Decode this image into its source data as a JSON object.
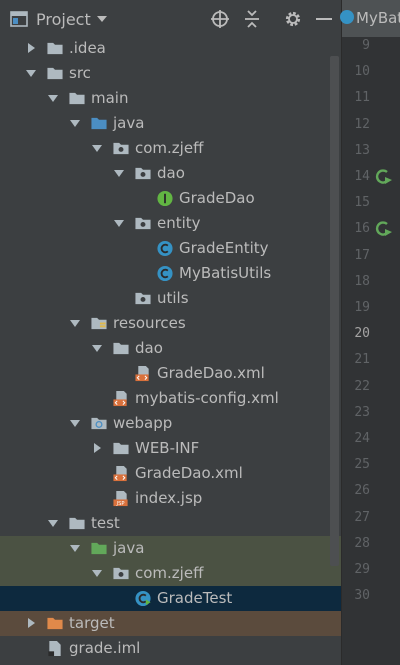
{
  "header": {
    "title": "Project",
    "editor_tab_label": "MyBat"
  },
  "tree": [
    {
      "label": "idea_folder",
      "text": ".idea",
      "icon": "folder-icon",
      "state": "collapsed"
    },
    {
      "label": "src",
      "text": "src",
      "icon": "folder-icon",
      "state": "expanded"
    },
    {
      "label": "main",
      "text": "main",
      "icon": "folder-icon",
      "state": "expanded"
    },
    {
      "label": "java",
      "text": "java",
      "icon": "source-folder-icon",
      "state": "expanded"
    },
    {
      "label": "com_zjeff",
      "text": "com.zjeff",
      "icon": "package-icon",
      "state": "expanded"
    },
    {
      "label": "dao",
      "text": "dao",
      "icon": "package-icon",
      "state": "expanded"
    },
    {
      "label": "GradeDao",
      "text": "GradeDao",
      "icon": "interface-icon",
      "state": "leaf"
    },
    {
      "label": "entity",
      "text": "entity",
      "icon": "package-icon",
      "state": "expanded"
    },
    {
      "label": "GradeEntity",
      "text": "GradeEntity",
      "icon": "class-icon",
      "state": "leaf"
    },
    {
      "label": "MyBatisUtils",
      "text": "MyBatisUtils",
      "icon": "class-icon",
      "state": "leaf"
    },
    {
      "label": "utils",
      "text": "utils",
      "icon": "package-icon",
      "state": "leaf"
    },
    {
      "label": "resources",
      "text": "resources",
      "icon": "resources-folder-icon",
      "state": "expanded"
    },
    {
      "label": "res_dao",
      "text": "dao",
      "icon": "folder-icon",
      "state": "expanded"
    },
    {
      "label": "GradeDao_xml",
      "text": "GradeDao.xml",
      "icon": "xml-file-icon",
      "state": "leaf"
    },
    {
      "label": "mybatis_config",
      "text": "mybatis-config.xml",
      "icon": "xml-file-icon",
      "state": "leaf"
    },
    {
      "label": "webapp",
      "text": "webapp",
      "icon": "web-folder-icon",
      "state": "expanded"
    },
    {
      "label": "WEB_INF",
      "text": "WEB-INF",
      "icon": "folder-icon",
      "state": "collapsed"
    },
    {
      "label": "web_GradeDao_xml",
      "text": "GradeDao.xml",
      "icon": "xml-file-icon",
      "state": "leaf"
    },
    {
      "label": "index_jsp",
      "text": "index.jsp",
      "icon": "jsp-file-icon",
      "state": "leaf"
    },
    {
      "label": "test",
      "text": "test",
      "icon": "folder-icon",
      "state": "expanded"
    },
    {
      "label": "test_java",
      "text": "java",
      "icon": "test-folder-icon",
      "state": "expanded"
    },
    {
      "label": "test_com_zjeff",
      "text": "com.zjeff",
      "icon": "package-icon",
      "state": "expanded"
    },
    {
      "label": "GradeTest",
      "text": "GradeTest",
      "icon": "test-class-icon",
      "state": "leaf"
    },
    {
      "label": "target",
      "text": "target",
      "icon": "excluded-folder-icon",
      "state": "collapsed"
    },
    {
      "label": "grade_iml",
      "text": "grade.iml",
      "icon": "iml-file-icon",
      "state": "leaf"
    }
  ],
  "line_numbers": [
    "9",
    "10",
    "11",
    "12",
    "13",
    "14",
    "15",
    "16",
    "17",
    "18",
    "19",
    "20",
    "21",
    "22",
    "23",
    "24",
    "25",
    "26",
    "27",
    "28",
    "29",
    "30"
  ],
  "current_line": "20",
  "colors": {
    "panel_bg": "#3c3f41",
    "selection": "#0d293e",
    "test_row": "#4b5243",
    "excluded_row": "#5b4b3d",
    "folder": "#aeb9c0",
    "source_folder": "#4b8ec3",
    "test_folder": "#62a85a",
    "excluded_folder": "#e0894a",
    "class_icon": "#3592c4",
    "interface_icon": "#62b543",
    "xml_icon": "#d9713c"
  }
}
